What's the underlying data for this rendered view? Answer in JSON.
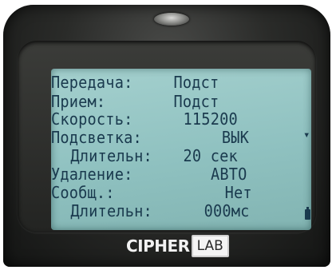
{
  "device": {
    "brand_cipher": "CIPHER",
    "brand_lab": "LAB"
  },
  "screen": {
    "rows": [
      {
        "label": "Передача:",
        "value": "Подст"
      },
      {
        "label": "Прием:",
        "value": "Подст"
      },
      {
        "label": "Скорость:",
        "value": "115200"
      },
      {
        "label": "Подсветка:",
        "value": "ВЫК"
      },
      {
        "label": " Длительн:",
        "value": "20 сек"
      },
      {
        "label": "Удаление:",
        "value": "АВТО"
      },
      {
        "label": "Сообщ.:",
        "value": "Нет"
      },
      {
        "label": " Длительн:",
        "value": "000мс"
      }
    ]
  },
  "icons": {
    "tick_mark": "arrow-marker-icon",
    "battery": "battery-icon"
  }
}
